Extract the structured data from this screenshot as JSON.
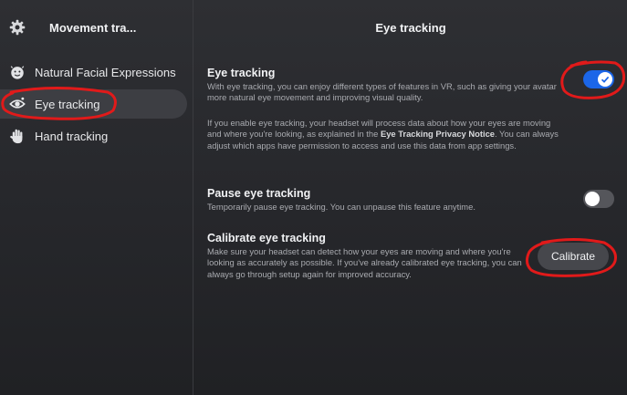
{
  "sidebar": {
    "title": "Movement tra...",
    "items": [
      {
        "label": "Natural Facial Expressions",
        "icon": "face-icon"
      },
      {
        "label": "Eye tracking",
        "icon": "eye-icon",
        "active": true
      },
      {
        "label": "Hand tracking",
        "icon": "hand-icon"
      }
    ]
  },
  "main": {
    "title": "Eye tracking",
    "eye_tracking": {
      "title": "Eye tracking",
      "desc1": "With eye tracking, you can enjoy different types of features in VR, such as giving your avatar more natural eye movement and improving visual quality.",
      "desc2_before": "If you enable eye tracking, your headset will process data about how your eyes are moving and where you're looking, as explained in the ",
      "desc2_link": "Eye Tracking Privacy Notice",
      "desc2_after": ". You can always adjust which apps have permission to access and use this data from app settings.",
      "enabled": true
    },
    "pause": {
      "title": "Pause eye tracking",
      "desc": "Temporarily pause eye tracking. You can unpause this feature anytime.",
      "enabled": false
    },
    "calibrate": {
      "title": "Calibrate eye tracking",
      "desc": "Make sure your headset can detect how your eyes are moving and where you're looking as accurately as possible. If you've already calibrated eye tracking, you can always go through setup again for improved accuracy.",
      "button_label": "Calibrate"
    }
  },
  "colors": {
    "accent": "#1b66e8",
    "annotation": "#e11a1a"
  }
}
